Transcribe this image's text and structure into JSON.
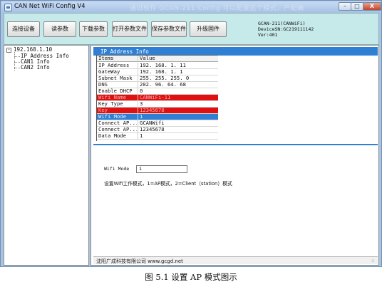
{
  "window": {
    "title": "CAN Net WiFi Config V4",
    "title_overlay": "通过软件 GCAN-211 Config 可以配置这个模式，产配确",
    "controls": {
      "minimize": "–",
      "maximize": "□",
      "close": "X"
    }
  },
  "toolbar": {
    "connect": "连接设备",
    "read": "读参数",
    "download": "下载参数",
    "open_file": "打开参数文件",
    "save_file": "保存参数文件",
    "firmware": "升级固件"
  },
  "device_info": {
    "line1": "GCAN-211(CANWiFi)",
    "line2": "DeviceSN:GC219111142",
    "line3": "Ver:401"
  },
  "tree": {
    "expander": "-",
    "root": "192.168.1.10",
    "children": [
      "IP Address Info",
      "CAN1 Info",
      "CAN2 Info"
    ]
  },
  "panel": {
    "title": "IP Address Info",
    "columns": [
      "Items",
      "Value"
    ],
    "rows": [
      {
        "item": "IP Address",
        "value": "192. 168. 1. 11"
      },
      {
        "item": "GateWay",
        "value": "192. 168. 1. 1"
      },
      {
        "item": "Subnet Mask",
        "value": "255. 255. 255. 0"
      },
      {
        "item": "DNS",
        "value": "202. 96. 64. 68"
      },
      {
        "item": "Enable DHCP",
        "value": "0"
      },
      {
        "item": "Wifi Name",
        "value": "CANWiFi-11"
      },
      {
        "item": "Key Type",
        "value": "3"
      },
      {
        "item": "Key",
        "value": "12345678"
      },
      {
        "item": "Wifi Mode",
        "value": "1"
      },
      {
        "item": "Connect AP...",
        "value": "GCANWifi"
      },
      {
        "item": "Connect AP...",
        "value": "12345678"
      },
      {
        "item": "Data Mode",
        "value": "1"
      }
    ]
  },
  "editor": {
    "label": "Wifi Mode",
    "value": "1",
    "description": "设置Wifi工作模式，1=AP模式，2=Client（station）模式"
  },
  "status_bar": {
    "text": "沈阳广成科技有限公司   www.gcgd.net",
    "grip": "::"
  },
  "caption": "图 5.1 设置 AP 模式图示",
  "colors": {
    "toolbar_bg": "#c6e9e9",
    "header_blue": "#2f80d4",
    "highlight_red": "#e01010",
    "frame": "#a9c4e3"
  }
}
